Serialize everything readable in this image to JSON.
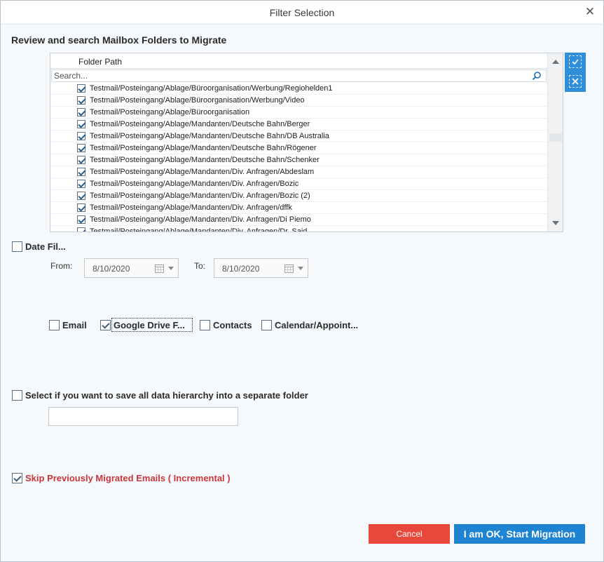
{
  "window": {
    "title": "Filter Selection",
    "close_icon": "close-icon"
  },
  "section": {
    "title": "Review and search Mailbox Folders to Migrate"
  },
  "grid": {
    "column_header": "Folder Path",
    "search_placeholder": "Search...",
    "rows": [
      {
        "path": "Testmail/Posteingang/Ablage/Büroorganisation/Werbung/Regiohelden1",
        "checked": true
      },
      {
        "path": "Testmail/Posteingang/Ablage/Büroorganisation/Werbung/Video",
        "checked": true
      },
      {
        "path": "Testmail/Posteingang/Ablage/Büroorganisation",
        "checked": true
      },
      {
        "path": "Testmail/Posteingang/Ablage/Mandanten/Deutsche Bahn/Berger",
        "checked": true
      },
      {
        "path": "Testmail/Posteingang/Ablage/Mandanten/Deutsche Bahn/DB Australia",
        "checked": true
      },
      {
        "path": "Testmail/Posteingang/Ablage/Mandanten/Deutsche Bahn/Rögener",
        "checked": true
      },
      {
        "path": "Testmail/Posteingang/Ablage/Mandanten/Deutsche Bahn/Schenker",
        "checked": true
      },
      {
        "path": "Testmail/Posteingang/Ablage/Mandanten/Div. Anfragen/Abdeslam",
        "checked": true
      },
      {
        "path": "Testmail/Posteingang/Ablage/Mandanten/Div. Anfragen/Bozic",
        "checked": true
      },
      {
        "path": "Testmail/Posteingang/Ablage/Mandanten/Div. Anfragen/Bozic (2)",
        "checked": true
      },
      {
        "path": "Testmail/Posteingang/Ablage/Mandanten/Div. Anfragen/dffk",
        "checked": true
      },
      {
        "path": "Testmail/Posteingang/Ablage/Mandanten/Div. Anfragen/Di Piemo",
        "checked": true
      },
      {
        "path": "Testmail/Posteingang/Ablage/Mandanten/Div. Anfragen/Dr. Said",
        "checked": true
      }
    ]
  },
  "date_filter": {
    "label": "Date Fil...",
    "checked": false,
    "from_label": "From:",
    "from_value": "8/10/2020",
    "to_label": "To:",
    "to_value": "8/10/2020"
  },
  "categories": [
    {
      "label": "Email",
      "checked": false
    },
    {
      "label": "Google Drive F...",
      "checked": true
    },
    {
      "label": "Contacts",
      "checked": false
    },
    {
      "label": "Calendar/Appoint...",
      "checked": false
    }
  ],
  "hierarchy": {
    "label": "Select if you want to save all data hierarchy into a separate folder",
    "checked": false,
    "folder_value": ""
  },
  "incremental": {
    "label": "Skip Previously Migrated Emails ( Incremental )",
    "checked": true
  },
  "buttons": {
    "cancel": "Cancel",
    "ok": "I am OK, Start Migration"
  },
  "colors": {
    "accent": "#1e84d1",
    "cancel": "#e8473c",
    "warning_text": "#c8363a"
  }
}
